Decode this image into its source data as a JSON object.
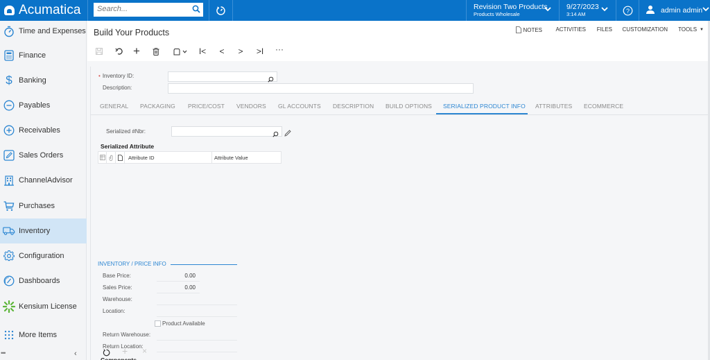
{
  "app": {
    "brand": "Acumatica",
    "search_placeholder": "Search...",
    "company": {
      "name": "Revision Two Products",
      "branch": "Products Wholesale"
    },
    "datetime": {
      "date": "9/27/2023",
      "time": "3:14 AM"
    },
    "user": "admin admin",
    "accent_color": "#0a73c9"
  },
  "sidebar": {
    "items": [
      {
        "label": "Time and Expenses",
        "icon": "stopwatch-icon"
      },
      {
        "label": "Finance",
        "icon": "calculator-icon"
      },
      {
        "label": "Banking",
        "icon": "dollar-icon"
      },
      {
        "label": "Payables",
        "icon": "minus-circle-icon"
      },
      {
        "label": "Receivables",
        "icon": "plus-circle-icon"
      },
      {
        "label": "Sales Orders",
        "icon": "pencil-square-icon"
      },
      {
        "label": "ChannelAdvisor",
        "icon": "building-icon"
      },
      {
        "label": "Purchases",
        "icon": "cart-icon"
      },
      {
        "label": "Inventory",
        "icon": "truck-icon",
        "active": true
      },
      {
        "label": "Configuration",
        "icon": "gear-icon"
      },
      {
        "label": "Dashboards",
        "icon": "gauge-icon"
      },
      {
        "label": "Kensium License",
        "icon": "kensium-logo-icon"
      },
      {
        "label": "More Items",
        "icon": "grid-dots-icon"
      }
    ],
    "footer_dots": "•••",
    "collapse_glyph": "‹"
  },
  "page": {
    "title": "Build Your Products",
    "top_links": [
      "NOTES",
      "ACTIVITIES",
      "FILES",
      "CUSTOMIZATION",
      "TOOLS"
    ],
    "toolbar": [
      "save",
      "undo",
      "add",
      "delete",
      "copy-paste",
      "first",
      "previous",
      "next",
      "last",
      "more"
    ]
  },
  "form": {
    "inventory_id_label": "Inventory ID:",
    "inventory_id_value": "",
    "description_label": "Description:",
    "description_value": ""
  },
  "tabs": [
    {
      "label": "GENERAL"
    },
    {
      "label": "PACKAGING"
    },
    {
      "label": "PRICE/COST"
    },
    {
      "label": "VENDORS"
    },
    {
      "label": "GL ACCOUNTS"
    },
    {
      "label": "DESCRIPTION"
    },
    {
      "label": "BUILD OPTIONS"
    },
    {
      "label": "SERIALIZED PRODUCT INFO",
      "active": true
    },
    {
      "label": "ATTRIBUTES"
    },
    {
      "label": "ECOMMERCE"
    }
  ],
  "serialized": {
    "nbr_label": "Serialized #Nbr:",
    "nbr_value": "",
    "attr_section_title": "Serialized Attribute",
    "columns": [
      "Attribute ID",
      "Attribute Value"
    ],
    "rows": []
  },
  "price_info": {
    "group_title": "INVENTORY / PRICE INFO",
    "base_price_label": "Base Price:",
    "base_price": "0.00",
    "sales_price_label": "Sales Price:",
    "sales_price": "0.00",
    "warehouse_label": "Warehouse:",
    "warehouse": "",
    "location_label": "Location:",
    "location": "",
    "product_available_label": "Product Available",
    "product_available": false,
    "return_warehouse_label": "Return Warehouse:",
    "return_warehouse": "",
    "return_location_label": "Return Location:",
    "return_location": ""
  },
  "components": {
    "title": "Components"
  }
}
